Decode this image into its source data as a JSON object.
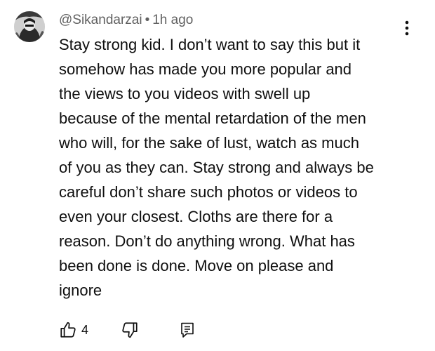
{
  "comment": {
    "author": "@Sikandarzai",
    "separator": "•",
    "time": "1h ago",
    "text_lines": [
      "Stay strong kid. I don’t want to say this but it",
      "somehow has made you more popular and",
      "the views to you videos with swell up",
      "because of the mental retardation of the men",
      "who will, for the sake of lust, watch as much",
      "of you as they can. Stay strong and always be",
      "careful don’t share such photos or videos to",
      "even your closest. Cloths are there for a",
      "reason. Don’t do anything wrong. What has",
      "been done is done. Move on please and",
      "ignore"
    ],
    "like_count": "4"
  },
  "icons": {
    "avatar": "avatar-image",
    "menu": "more-vert-icon",
    "like": "thumb-up-icon",
    "dislike": "thumb-down-icon",
    "reply": "reply-comment-icon"
  },
  "colors": {
    "text": "#0f0f0f",
    "secondary_text": "#606060",
    "background": "#ffffff"
  }
}
